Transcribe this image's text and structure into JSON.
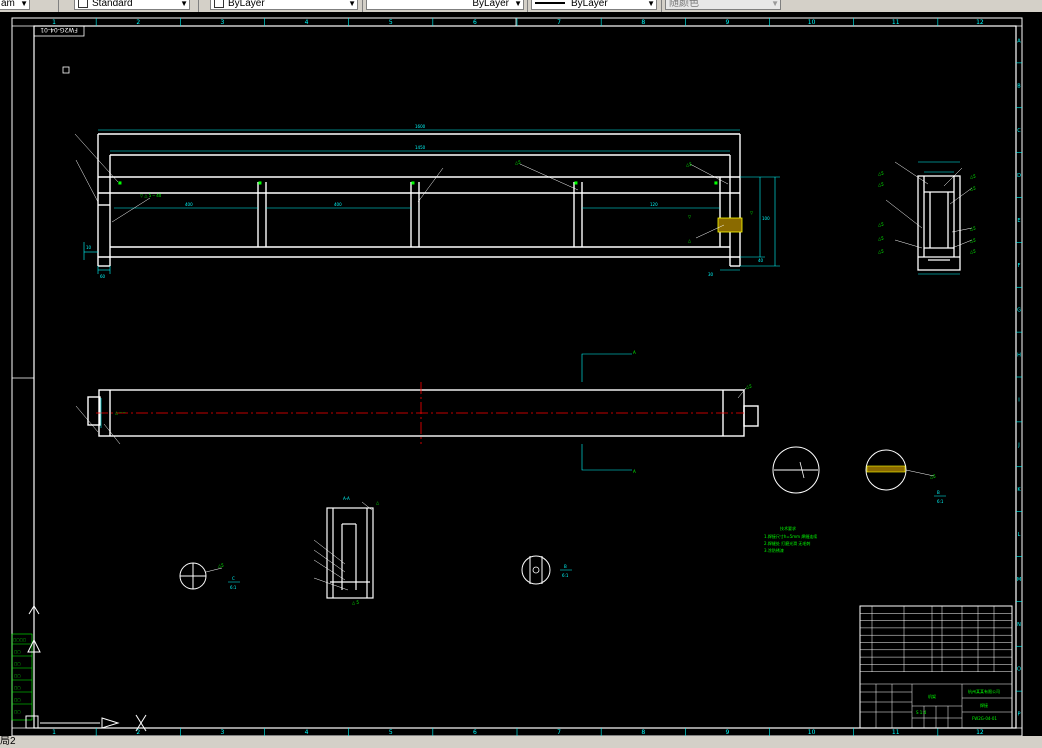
{
  "toolbar": {
    "textstyle_fragment": "am",
    "dimstyle_value": "Standard",
    "color_value": "ByLayer",
    "linetype_value": "ByLayer",
    "lineweight_value": "ByLayer",
    "plotstyle_value": "随颜色"
  },
  "frame": {
    "col_labels": [
      "1",
      "2",
      "3",
      "4",
      "5",
      "6",
      "7",
      "8",
      "9",
      "10",
      "11",
      "12"
    ],
    "row_labels": [
      "A",
      "B",
      "C",
      "D",
      "E",
      "F",
      "G",
      "H",
      "I",
      "J",
      "K",
      "L",
      "M",
      "N",
      "O",
      "P"
    ],
    "drawing_number_rotated": "FW2G-04-01"
  },
  "tab": {
    "label": "局2"
  },
  "colors": {
    "frame": "#ffffff",
    "dimension": "#00ffff",
    "annotation": "#00ff00",
    "centerline": "#ff0000",
    "weld": "#ffff00",
    "background": "#000000"
  }
}
